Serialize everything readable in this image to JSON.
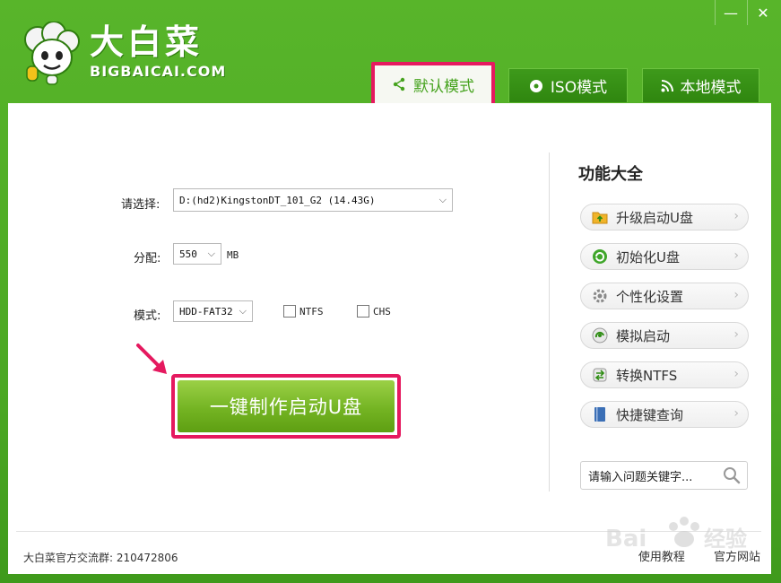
{
  "window": {
    "minimize_glyph": "—",
    "close_glyph": "✕"
  },
  "brand": {
    "name_cn": "大白菜",
    "name_en": "BIGBAICAI.COM"
  },
  "tabs": [
    {
      "label": "默认模式",
      "icon": "share-icon",
      "active": true
    },
    {
      "label": "ISO模式",
      "icon": "disc-icon",
      "active": false
    },
    {
      "label": "本地模式",
      "icon": "rss-icon",
      "active": false
    }
  ],
  "form": {
    "device_label": "请选择:",
    "device_value": "D:(hd2)KingstonDT_101_G2 (14.43G)",
    "alloc_label": "分配:",
    "alloc_value": "550",
    "alloc_unit": "MB",
    "mode_label": "模式:",
    "mode_value": "HDD-FAT32",
    "ntfs_label": "NTFS",
    "ntfs_checked": false,
    "chs_label": "CHS",
    "chs_checked": false,
    "make_button": "一键制作启动U盘"
  },
  "features": {
    "title": "功能大全",
    "items": [
      {
        "label": "升级启动U盘",
        "icon": "folder-upgrade-icon"
      },
      {
        "label": "初始化U盘",
        "icon": "recycle-icon"
      },
      {
        "label": "个性化设置",
        "icon": "gear-icon"
      },
      {
        "label": "模拟启动",
        "icon": "simulate-icon"
      },
      {
        "label": "转换NTFS",
        "icon": "convert-icon"
      },
      {
        "label": "快捷键查询",
        "icon": "book-icon"
      }
    ],
    "search_placeholder": "请输入问题关键字..."
  },
  "footer": {
    "qq_group": "大白菜官方交流群: 210472806",
    "links": [
      "使用教程",
      "官方网站"
    ]
  },
  "colors": {
    "brand_green": "#4ba723",
    "highlight": "#e5195f",
    "button_green": "#74b423"
  }
}
